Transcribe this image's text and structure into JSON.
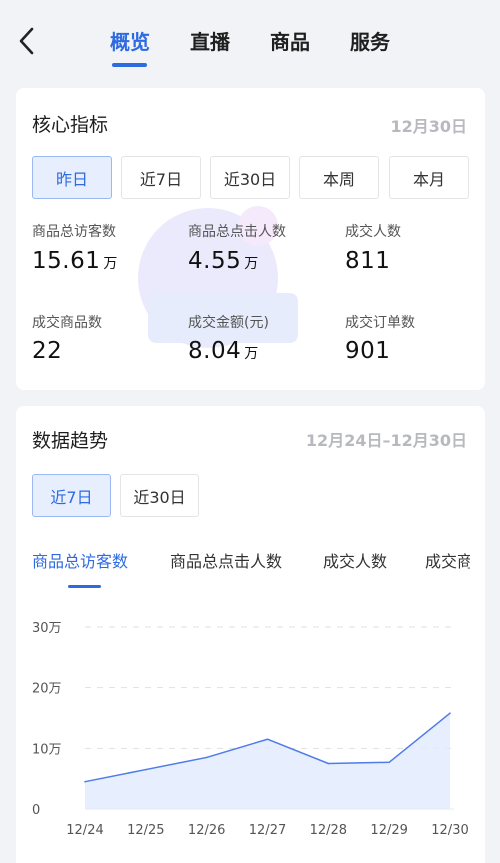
{
  "nav": {
    "tabs": [
      {
        "label": "概览",
        "active": true
      },
      {
        "label": "直播",
        "active": false
      },
      {
        "label": "商品",
        "active": false
      },
      {
        "label": "服务",
        "active": false
      }
    ]
  },
  "core": {
    "title": "核心指标",
    "date": "12月30日",
    "ranges": [
      {
        "label": "昨日",
        "active": true
      },
      {
        "label": "近7日",
        "active": false
      },
      {
        "label": "近30日",
        "active": false
      },
      {
        "label": "本周",
        "active": false
      },
      {
        "label": "本月",
        "active": false
      }
    ],
    "metrics": [
      {
        "label": "商品总访客数",
        "value": "15.61",
        "unit": "万"
      },
      {
        "label": "商品总点击人数",
        "value": "4.55",
        "unit": "万"
      },
      {
        "label": "成交人数",
        "value": "811",
        "unit": ""
      },
      {
        "label": "成交商品数",
        "value": "22",
        "unit": ""
      },
      {
        "label": "成交金额(元)",
        "value": "8.04",
        "unit": "万"
      },
      {
        "label": "成交订单数",
        "value": "901",
        "unit": ""
      }
    ]
  },
  "trend": {
    "title": "数据趋势",
    "date_range": "12月24日–12月30日",
    "ranges": [
      {
        "label": "近7日",
        "active": true
      },
      {
        "label": "近30日",
        "active": false
      }
    ],
    "subtabs": [
      {
        "label": "商品总访客数",
        "active": true
      },
      {
        "label": "商品总点击人数",
        "active": false
      },
      {
        "label": "成交人数",
        "active": false
      },
      {
        "label": "成交商品数",
        "active": false
      }
    ]
  },
  "chart_data": {
    "type": "area",
    "categories": [
      "12/24",
      "12/25",
      "12/26",
      "12/27",
      "12/28",
      "12/29",
      "12/30"
    ],
    "series": [
      {
        "values": [
          4.5,
          6.5,
          8.5,
          11.5,
          7.5,
          7.7,
          15.8
        ]
      }
    ],
    "ylim": [
      0,
      30
    ],
    "yticks": [
      0,
      10,
      20,
      30
    ],
    "ytick_labels": [
      "0",
      "10万",
      "20万",
      "30万"
    ],
    "grid": true,
    "colors": {
      "line": "#4f7be8",
      "fill": "#e3ebfd"
    }
  },
  "colors": {
    "accent": "#2e6ae0"
  }
}
